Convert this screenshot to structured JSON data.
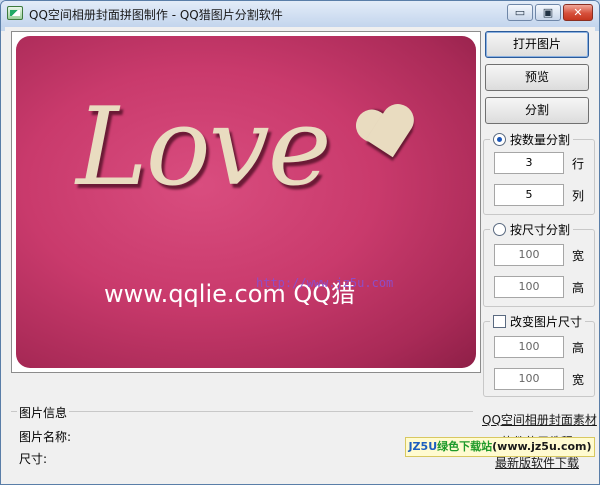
{
  "window": {
    "title": "QQ空间相册封面拼图制作 - QQ猎图片分割软件",
    "minimize_glyph": "▭",
    "maximize_glyph": "▣",
    "close_glyph": "✕"
  },
  "preview": {
    "photo_text": "Love",
    "photo_url": "www.qqlie.com QQ猎",
    "photo_watermark": "http://www.jz5u.com"
  },
  "buttons": {
    "open_image": "打开图片",
    "preview": "预览",
    "split": "分割"
  },
  "split_by_count": {
    "label": "按数量分割",
    "selected": true,
    "rows_value": "3",
    "rows_unit": "行",
    "cols_value": "5",
    "cols_unit": "列"
  },
  "split_by_size": {
    "label": "按尺寸分割",
    "selected": false,
    "width_value": "100",
    "width_unit": "宽",
    "height_value": "100",
    "height_unit": "高"
  },
  "resize_image": {
    "label": "改变图片尺寸",
    "checked": false,
    "height_value": "100",
    "height_unit": "高",
    "width_value": "100",
    "width_unit": "宽"
  },
  "image_info": {
    "legend": "图片信息",
    "name_label": "图片名称:",
    "size_label": "尺寸:"
  },
  "links": {
    "cover_material": "QQ空间相册封面素材",
    "tutorial": "软件使用教程",
    "latest_version": "最新版软件下载"
  },
  "badge": {
    "prefix": "JZ5U",
    "middle": "绿色下载站",
    "suffix": "(www.jz5u.com)"
  }
}
